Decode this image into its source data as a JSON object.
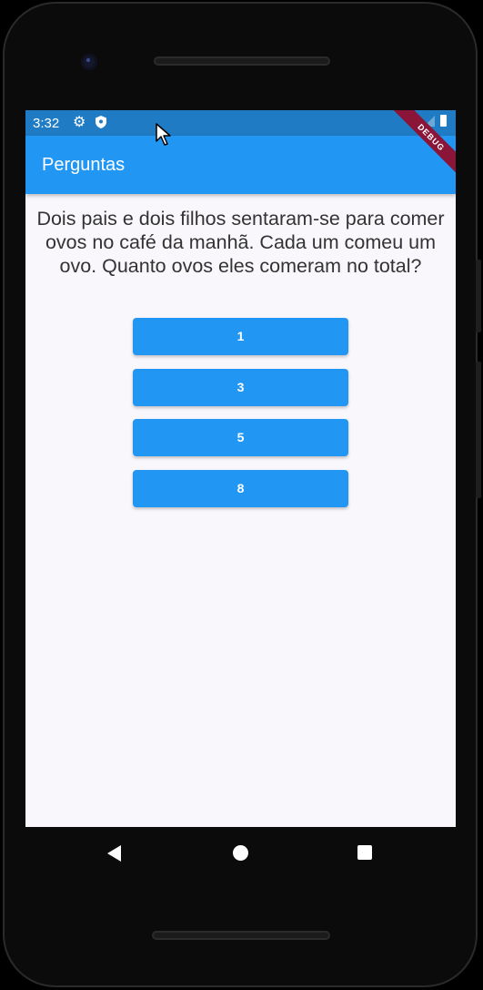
{
  "status_bar": {
    "time": "3:32",
    "icons": [
      "gear-icon",
      "shield-icon",
      "wifi-icon",
      "signal-icon",
      "battery-icon"
    ]
  },
  "app_bar": {
    "title": "Perguntas",
    "color": "#2196f3"
  },
  "debug_banner": "DEBUG",
  "quiz": {
    "question": "Dois pais e dois filhos sentaram-se para comer ovos no café da manhã. Cada um comeu um ovo. Quanto ovos eles comeram no total?",
    "answers": [
      "1",
      "3",
      "5",
      "8"
    ]
  },
  "nav_bar": {
    "icons": [
      "back-icon",
      "home-icon",
      "recents-icon"
    ]
  }
}
